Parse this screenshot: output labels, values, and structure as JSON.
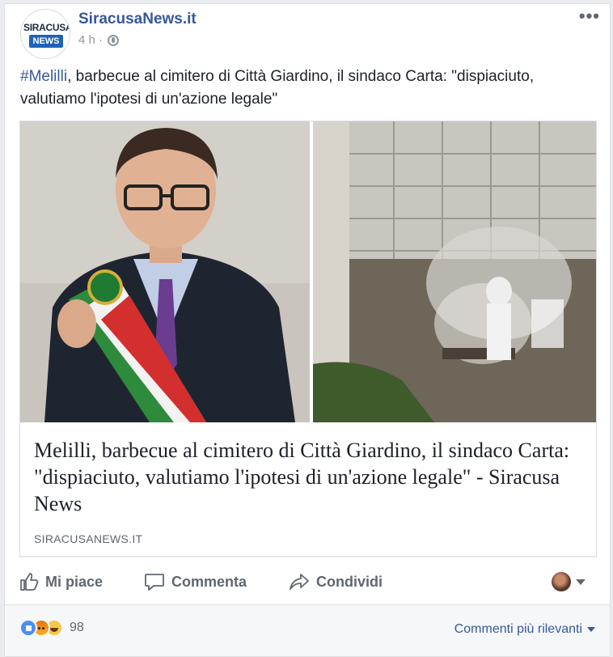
{
  "post": {
    "page_name": "SiracusaNews.it",
    "avatar_top": "SIRACUSA",
    "avatar_bottom": "NEWS",
    "time": "4 h",
    "dot": "·",
    "more_menu": "•••",
    "hashtag": "#Melilli",
    "text": ", barbecue al cimitero di Città Giardino, il sindaco Carta: \"dispiaciuto, valutiamo l'ipotesi di un'azione legale\""
  },
  "link": {
    "title": "Melilli, barbecue al cimitero di Città Giardino, il sindaco Carta: \"dispiaciuto, valutiamo l'ipotesi di un'azione legale\" - Siracusa News",
    "domain": "SIRACUSANEWS.IT"
  },
  "actions": {
    "like": "Mi piace",
    "comment": "Commenta",
    "share": "Condividi"
  },
  "footer": {
    "reaction_count": "98",
    "sort_label": "Commenti più rilevanti"
  },
  "icons": [
    "like-reaction-icon",
    "angry-reaction-icon",
    "haha-reaction-icon",
    "globe-icon",
    "thumbs-up-icon",
    "comment-icon",
    "share-icon"
  ],
  "colors": {
    "link_blue": "#365899",
    "gray_text": "#606770",
    "like_blue": "#4b8ef1"
  }
}
